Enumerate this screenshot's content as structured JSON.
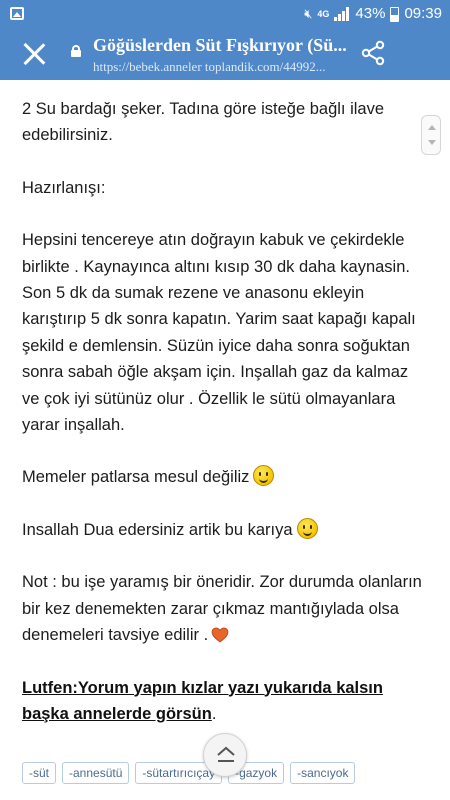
{
  "status_bar": {
    "network": "4G",
    "battery": "43%",
    "time": "09:39"
  },
  "browser": {
    "title": "Göğüslerden Süt Fışkırıyor (Sü...",
    "url": "https://bebek.anneler toplandik.com/44992..."
  },
  "article": {
    "line_sugar": "2 Su bardağı şeker.  Tadına göre isteğe bağlı ilave edebilirsiniz.",
    "preparation_heading": "Hazırlanışı:",
    "preparation_text": "Hepsini tencereye atın doğrayın kabuk ve çekirdekle birlikte . Kaynayınca altını kısıp 30 dk daha kaynasin. Son 5 dk da sumak rezene ve anasonu ekleyin karıştırıp 5 dk sonra kapatın.  Yarim saat kapağı kapalı şekild e demlensin.  Süzün iyice daha sonra soğuktan sonra sabah öğle akşam için.  Inşallah gaz da kalmaz ve çok iyi sütünüz olur . Özellik le sütü olmayanlara yarar inşallah.",
    "joke_line": "Memeler patlarsa mesul değiliz",
    "prayer_line": "Insallah Dua edersiniz artik bu karıya",
    "note_text": "Not : bu işe yaramış bir öneridir.  Zor durumda olanların bir kez denemekten zarar çıkmaz mantığıylada olsa denemeleri tavsiye edilir .",
    "cta_text": "Lutfen:Yorum yapın kızlar yazı yukarıda kalsın başka annelerde görsün",
    "cta_period": "."
  },
  "tags": [
    "-süt",
    "-annesütü",
    "-sütartırıcıçay",
    "-gazyok",
    "-sancıyok"
  ],
  "colors": {
    "toolbar": "#4f88c9",
    "heart": "#e8652a"
  }
}
